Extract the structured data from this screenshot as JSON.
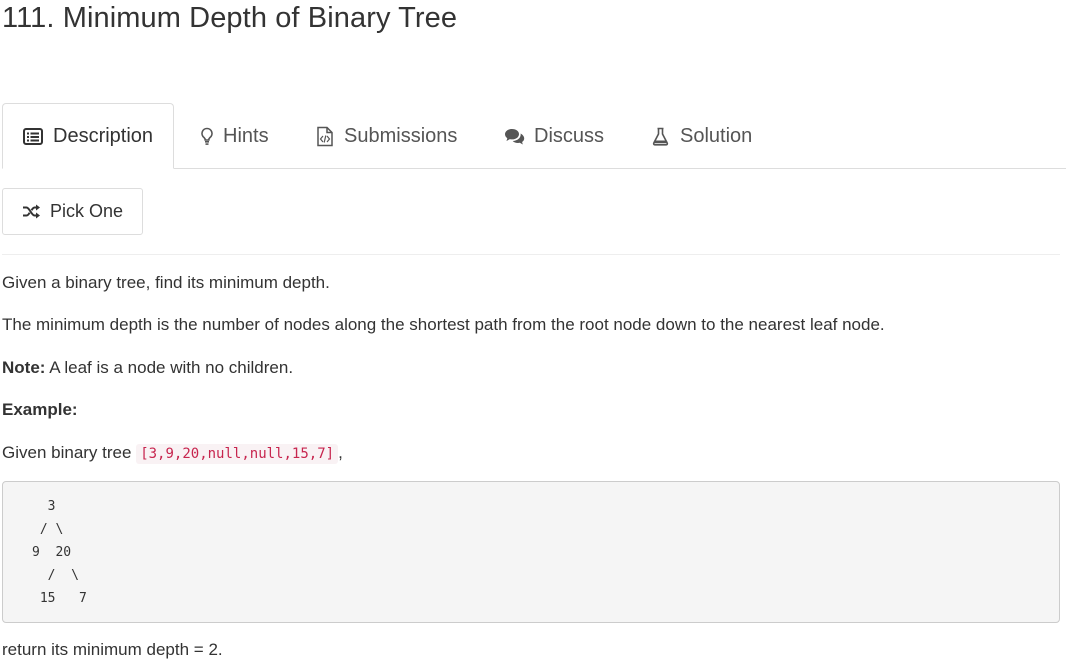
{
  "problem": {
    "title": "111. Minimum Depth of Binary Tree"
  },
  "tabs": [
    {
      "label": "Description",
      "icon": "list-icon",
      "active": true
    },
    {
      "label": "Hints",
      "icon": "lightbulb-icon",
      "active": false
    },
    {
      "label": "Submissions",
      "icon": "code-file-icon",
      "active": false
    },
    {
      "label": "Discuss",
      "icon": "comments-icon",
      "active": false
    },
    {
      "label": "Solution",
      "icon": "flask-icon",
      "active": false
    }
  ],
  "pick_one": {
    "label": "Pick One",
    "icon": "shuffle-icon"
  },
  "description": {
    "p1": "Given a binary tree, find its minimum depth.",
    "p2": "The minimum depth is the number of nodes along the shortest path from the root node down to the nearest leaf node.",
    "note_label": "Note:",
    "note_text": " A leaf is a node with no children.",
    "example_label": "Example:",
    "given_prefix": "Given binary tree ",
    "given_code": "[3,9,20,null,null,15,7]",
    "given_suffix": ",",
    "tree_diagram": "  3\n / \\\n9  20\n  /  \\\n 15   7",
    "result": "return its minimum depth = 2."
  },
  "colors": {
    "code_text": "#c7254e",
    "code_bg": "#f9f2f4",
    "pre_bg": "#f5f5f5"
  }
}
